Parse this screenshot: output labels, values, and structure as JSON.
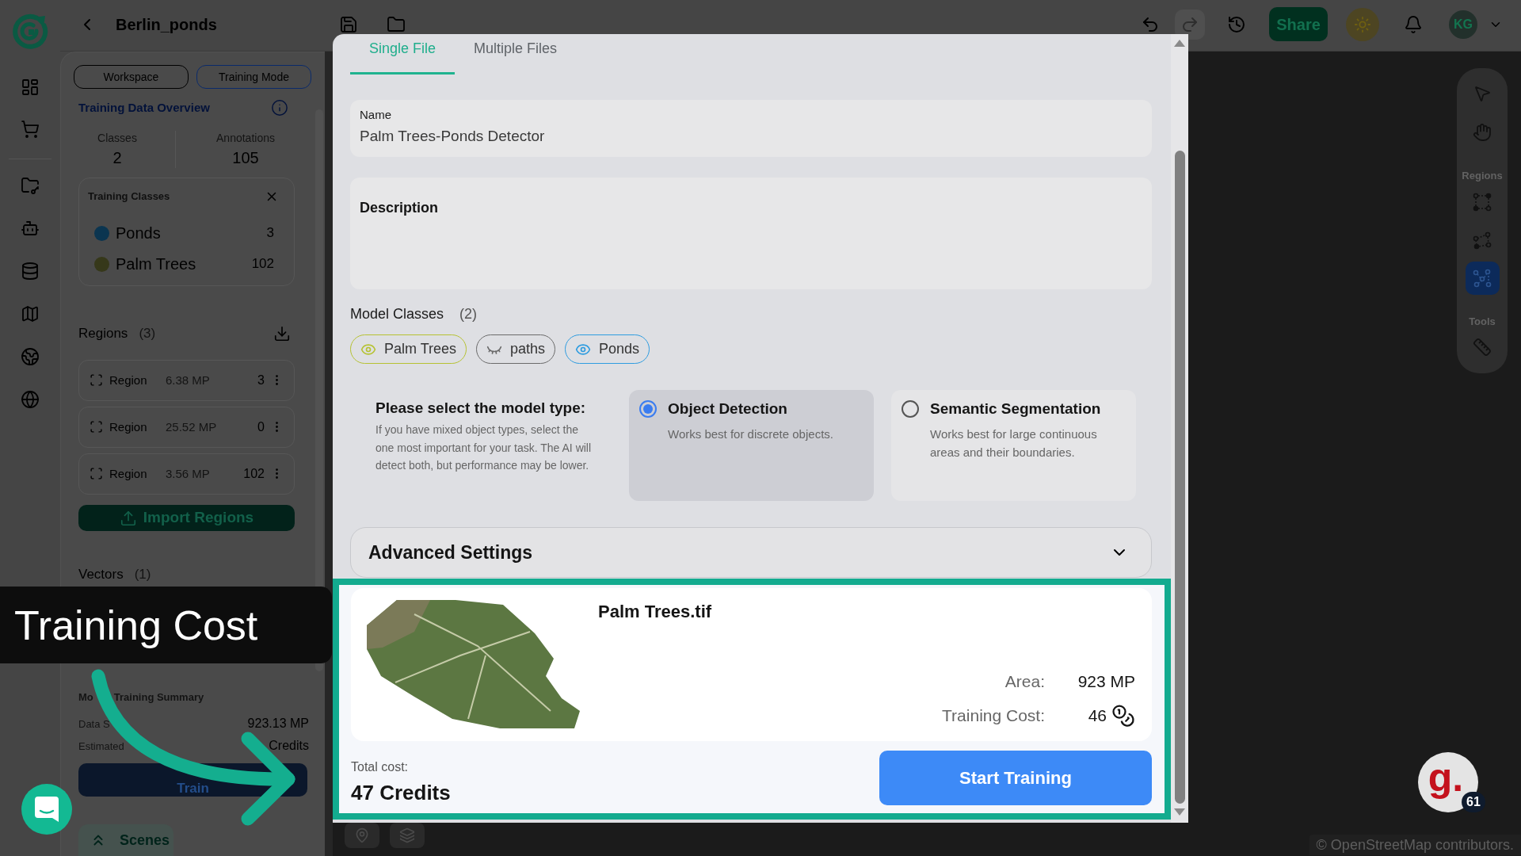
{
  "top_bar": {
    "title": "Berlin_ponds",
    "share": "Share",
    "user_initials": "KG"
  },
  "left_panel": {
    "mode_buttons": [
      {
        "label": "Workspace",
        "selected": false
      },
      {
        "label": "Training Mode",
        "selected": true
      }
    ],
    "overview_title": "Training Data Overview",
    "stats": [
      {
        "label": "Classes",
        "value": "2"
      },
      {
        "label": "Annotations",
        "value": "105"
      }
    ],
    "training_classes": {
      "title": "Training Classes",
      "items": [
        {
          "name": "Ponds",
          "count": "3",
          "color": "#0b3550"
        },
        {
          "name": "Palm Trees",
          "count": "102",
          "color": "#36381a"
        }
      ]
    },
    "regions": {
      "title": "Regions",
      "count": "(3)",
      "items": [
        {
          "label": "Region",
          "size": "6.38 MP",
          "count": "3"
        },
        {
          "label": "Region",
          "size": "25.52 MP",
          "count": "0"
        },
        {
          "label": "Region",
          "size": "3.56 MP",
          "count": "102"
        }
      ]
    },
    "import_button": "Import Regions",
    "vectors": {
      "title": "Vectors",
      "count": "(1)"
    },
    "summary": {
      "title_parts": [
        "Mo",
        "Training Summary"
      ],
      "rows": [
        {
          "label": "Data S",
          "value": "923.13 MP"
        },
        {
          "label": "Estimated",
          "value": "Credits"
        }
      ],
      "train_button": "Train"
    },
    "scenes_button": "Scenes"
  },
  "map": {
    "toolbar": {
      "top_tools": [
        {
          "kind": "pointer",
          "selected": false
        },
        {
          "kind": "hand",
          "selected": false
        }
      ],
      "regions_label": "Regions",
      "region_tools": [
        {
          "kind": "rectangle",
          "selected": false
        },
        {
          "kind": "polygon",
          "selected": false
        },
        {
          "kind": "points",
          "selected": true
        }
      ],
      "tools_label": "Tools",
      "tools": [
        {
          "kind": "ruler",
          "selected": false
        }
      ]
    },
    "attribution": "© OpenStreetMap contributors."
  },
  "modal": {
    "tabs": [
      {
        "label": "Single File",
        "selected": true
      },
      {
        "label": "Multiple Files",
        "selected": false
      }
    ],
    "name_field": {
      "label": "Name",
      "value": "Palm Trees-Ponds Detector"
    },
    "description_field": {
      "label": "Description"
    },
    "model_classes": {
      "title": "Model Classes",
      "count": "(2)",
      "chips": [
        {
          "label": "Palm Trees",
          "visible": true,
          "color": "#b6c232"
        },
        {
          "label": "paths",
          "visible": false,
          "color": "#6b6b6b"
        },
        {
          "label": "Ponds",
          "visible": true,
          "color": "#2e9ce0"
        }
      ]
    },
    "model_type": {
      "prompt": "Please select the model type:",
      "hint": "If you have mixed object types, select the one most important for your task. The AI will detect both, but performance may be lower.",
      "options": [
        {
          "title": "Object Detection",
          "description": "Works best for discrete objects.",
          "selected": true
        },
        {
          "title": "Semantic Segmentation",
          "description": "Works best for large continuous areas and their boundaries.",
          "selected": false
        }
      ]
    },
    "advanced_settings": {
      "label": "Advanced Settings",
      "expanded": false
    },
    "file": {
      "name": "Palm Trees.tif",
      "details": [
        {
          "label": "Area:",
          "value": "923 MP",
          "kind": "plain"
        },
        {
          "label": "Training Cost:",
          "value": "46",
          "kind": "credits"
        }
      ]
    },
    "total": {
      "label": "Total cost:",
      "value": "47 Credits"
    },
    "start_button": "Start Training"
  },
  "annotation": {
    "callout": "Training Cost"
  },
  "guide_avatar": {
    "logo": "g.",
    "badge": "61"
  }
}
